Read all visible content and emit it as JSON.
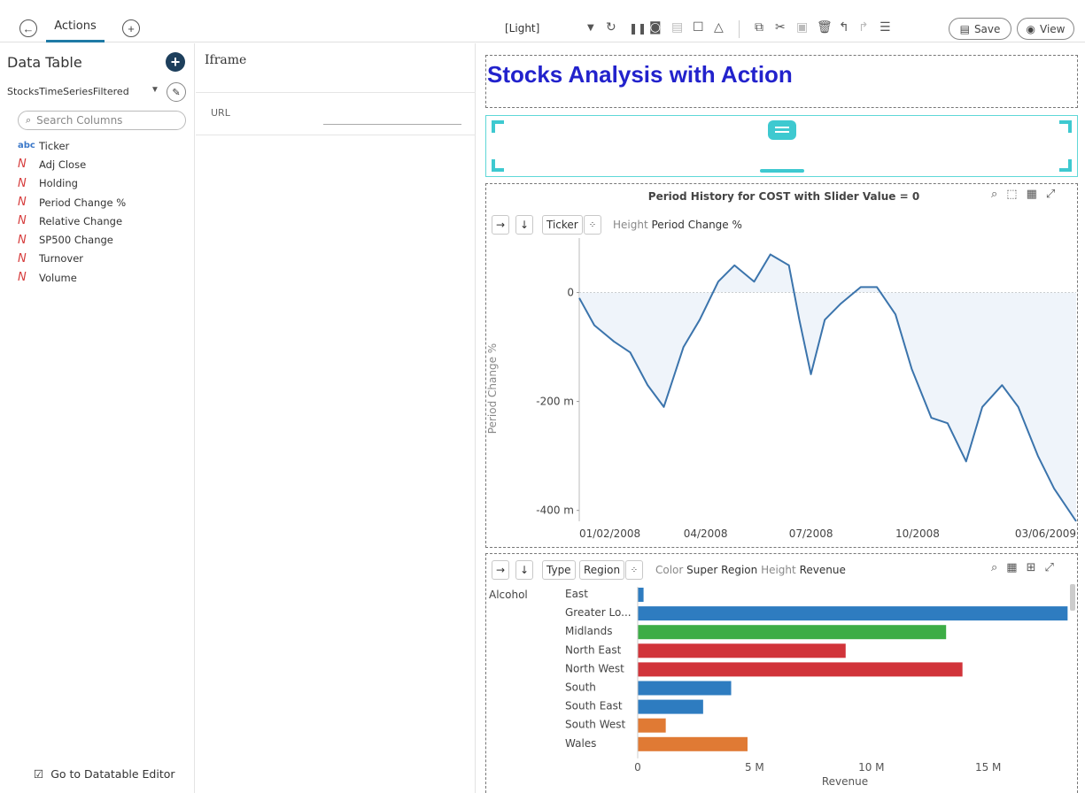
{
  "topbar": {
    "tab_label": "Actions",
    "theme": "[Light]",
    "save_label": "Save",
    "view_label": "View"
  },
  "left_panel": {
    "title": "Data Table",
    "datasource": "StocksTimeSeriesFiltered",
    "search_placeholder": "Search Columns",
    "columns": [
      {
        "type": "abc",
        "name": "Ticker"
      },
      {
        "type": "N",
        "name": "Adj Close"
      },
      {
        "type": "N",
        "name": "Holding"
      },
      {
        "type": "N",
        "name": "Period Change %"
      },
      {
        "type": "N",
        "name": "Relative Change"
      },
      {
        "type": "N",
        "name": "SP500 Change"
      },
      {
        "type": "N",
        "name": "Turnover"
      },
      {
        "type": "N",
        "name": "Volume"
      }
    ],
    "footer_link": "Go to Datatable Editor"
  },
  "middle_panel": {
    "title": "Iframe",
    "url_label": "URL",
    "url_value": ""
  },
  "canvas": {
    "dashboard_title": "Stocks Analysis with Action",
    "line_panel": {
      "title": "Period History for COST with Slider Value = 0",
      "chip_ticker": "Ticker",
      "height_label": "Height",
      "height_value": "Period Change %"
    },
    "bar_panel": {
      "chip_type": "Type",
      "chip_region": "Region",
      "color_label": "Color",
      "color_value": "Super Region",
      "height_label": "Height",
      "height_value": "Revenue"
    }
  },
  "chart_data": [
    {
      "type": "line",
      "title": "Period History for COST with Slider Value = 0",
      "xlabel": "",
      "ylabel": "Period Change %",
      "x_ticks": [
        "01/02/2008",
        "04/2008",
        "07/2008",
        "10/2008",
        "03/06/2009"
      ],
      "y_ticks": [
        "0",
        "-200 m",
        "-400 m"
      ],
      "ylim": [
        -0.42,
        0.1
      ],
      "series": [
        {
          "points": [
            [
              "2008-01-02",
              -0.01
            ],
            [
              "2008-01-15",
              -0.06
            ],
            [
              "2008-02-01",
              -0.09
            ],
            [
              "2008-02-15",
              -0.11
            ],
            [
              "2008-03-01",
              -0.17
            ],
            [
              "2008-03-15",
              -0.21
            ],
            [
              "2008-04-01",
              -0.1
            ],
            [
              "2008-04-15",
              -0.05
            ],
            [
              "2008-05-01",
              0.02
            ],
            [
              "2008-05-15",
              0.05
            ],
            [
              "2008-06-01",
              0.02
            ],
            [
              "2008-06-15",
              0.07
            ],
            [
              "2008-07-01",
              0.05
            ],
            [
              "2008-07-10",
              -0.05
            ],
            [
              "2008-07-20",
              -0.15
            ],
            [
              "2008-08-01",
              -0.05
            ],
            [
              "2008-08-15",
              -0.02
            ],
            [
              "2008-09-01",
              0.01
            ],
            [
              "2008-09-15",
              0.01
            ],
            [
              "2008-10-01",
              -0.04
            ],
            [
              "2008-10-15",
              -0.14
            ],
            [
              "2008-11-01",
              -0.23
            ],
            [
              "2008-11-15",
              -0.24
            ],
            [
              "2008-12-01",
              -0.31
            ],
            [
              "2008-12-15",
              -0.21
            ],
            [
              "2009-01-01",
              -0.17
            ],
            [
              "2009-01-15",
              -0.21
            ],
            [
              "2009-02-01",
              -0.3
            ],
            [
              "2009-02-15",
              -0.36
            ],
            [
              "2009-03-06",
              -0.42
            ]
          ]
        }
      ]
    },
    {
      "type": "bar",
      "orientation": "horizontal",
      "group_label": "Alcohol",
      "xlabel": "Revenue",
      "x_ticks": [
        "0",
        "5 M",
        "10 M",
        "15 M"
      ],
      "xlim": [
        0,
        18500000
      ],
      "categories": [
        "East",
        "Greater Lo...",
        "Midlands",
        "North East",
        "North West",
        "South",
        "South East",
        "South West",
        "Wales"
      ],
      "values": [
        250000,
        18400000,
        13200000,
        8900000,
        13900000,
        4000000,
        2800000,
        1200000,
        4700000
      ],
      "colors": [
        "#2e7cc0",
        "#2e7cc0",
        "#3dad46",
        "#d1343a",
        "#d1343a",
        "#2e7cc0",
        "#2e7cc0",
        "#e07a34",
        "#e07a34"
      ]
    }
  ]
}
